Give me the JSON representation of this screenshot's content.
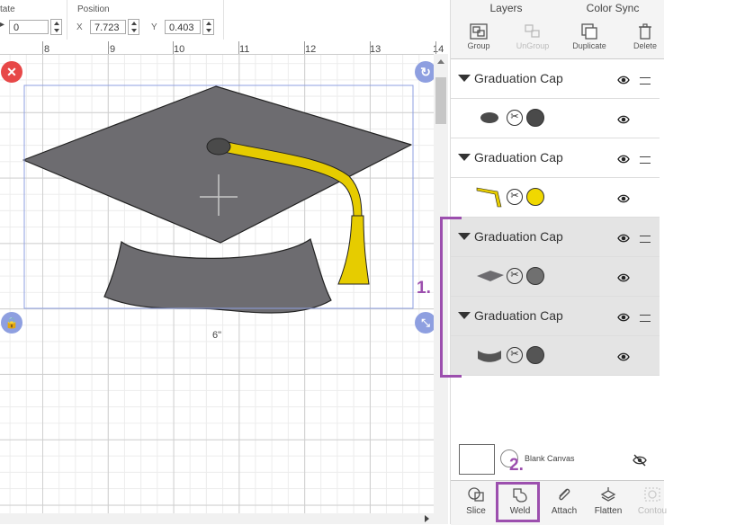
{
  "propbar": {
    "rotate_label": "tate",
    "rotate_value": "0",
    "position_label": "Position",
    "x_label": "X",
    "x_value": "7.723",
    "y_label": "Y",
    "y_value": "0.403"
  },
  "ruler": {
    "numbers": [
      "8",
      "9",
      "10",
      "11",
      "12",
      "13",
      "14"
    ]
  },
  "canvas": {
    "width_label": "6\"",
    "colors": {
      "cap_gray": "#6d6c70",
      "tassel_yellow": "#e6cc00",
      "selection": "#8e9fe0",
      "delete_red": "#e74848",
      "handle_blue": "#8e9fe0"
    }
  },
  "panel": {
    "tabs": [
      "Layers",
      "Color Sync"
    ],
    "toolbar": [
      {
        "label": "Group",
        "icon": "group-icon",
        "enabled": true
      },
      {
        "label": "UnGroup",
        "icon": "ungroup-icon",
        "enabled": false
      },
      {
        "label": "Duplicate",
        "icon": "duplicate-icon",
        "enabled": true
      },
      {
        "label": "Delete",
        "icon": "trash-icon",
        "enabled": true
      }
    ],
    "groups": [
      {
        "name": "Graduation Cap",
        "child_shape": "button-oval",
        "swatch": "#4a4a4a",
        "highlighted": false
      },
      {
        "name": "Graduation Cap",
        "child_shape": "tassel",
        "swatch": "#f0d800",
        "highlighted": false
      },
      {
        "name": "Graduation Cap",
        "child_shape": "cap-top",
        "swatch": "#707070",
        "highlighted": true
      },
      {
        "name": "Graduation Cap",
        "child_shape": "cap-base",
        "swatch": "#555555",
        "highlighted": true
      }
    ],
    "blank_canvas_label": "Blank Canvas",
    "actions": [
      {
        "label": "Slice",
        "icon": "slice-icon",
        "enabled": true
      },
      {
        "label": "Weld",
        "icon": "weld-icon",
        "enabled": true
      },
      {
        "label": "Attach",
        "icon": "attach-icon",
        "enabled": true
      },
      {
        "label": "Flatten",
        "icon": "flatten-icon",
        "enabled": true
      },
      {
        "label": "Contou",
        "icon": "contour-icon",
        "enabled": false
      }
    ]
  },
  "annotations": {
    "step1": "1.",
    "step2": "2.",
    "color": "#9c4fae"
  }
}
